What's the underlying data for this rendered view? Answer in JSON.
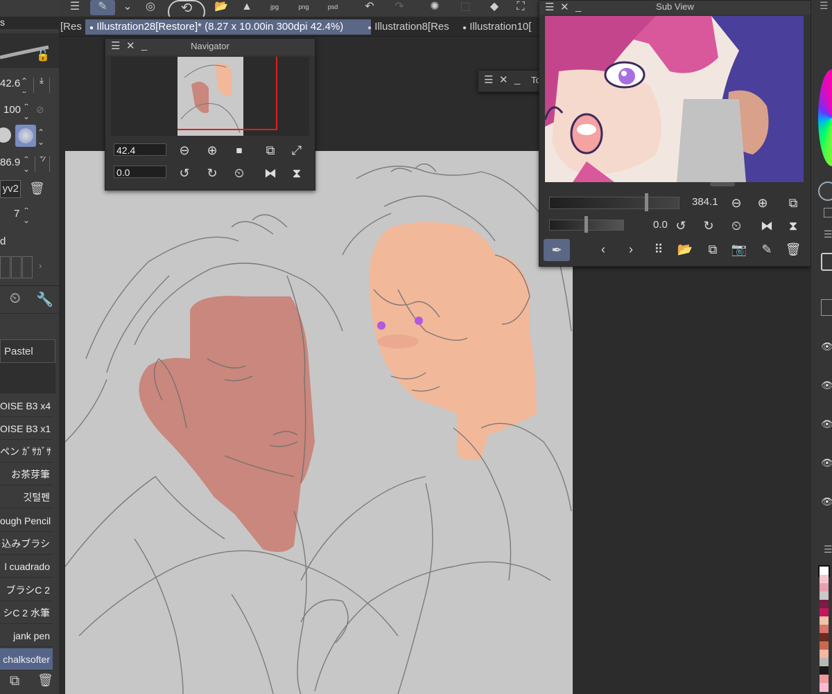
{
  "toolbar": {
    "icons": [
      "menu-icon",
      "pen-tool-icon",
      "chevron-down-icon",
      "spiral-icon",
      "rotate-icon",
      "folder-icon",
      "image-icon",
      "export-jpg-icon",
      "export-png-icon",
      "export-psd-icon",
      "undo-icon",
      "redo-icon",
      "loading-icon",
      "transform-icon",
      "fill-icon",
      "crop-icon"
    ],
    "export_jpg": "jpg",
    "export_png": "png",
    "export_psd": "psd"
  },
  "tabs": [
    {
      "label": "[Res"
    },
    {
      "label": "Illustration28[Restore]* (8.27 x 10.00in 300dpi 42.4%)"
    },
    {
      "label": "Illustration8[Res"
    },
    {
      "label": "Illustration10["
    }
  ],
  "left_panel": {
    "header_fragment": "s",
    "size_value": "42.6",
    "opacity_value": "100",
    "density_value": "86.9",
    "brush_name_field": "yv2",
    "stabilizer_value": "7",
    "blend_label": "d",
    "group_label": "Pastel",
    "brushes": [
      "OISE B3 x4",
      "OISE B3 x1",
      "ペン ｶﾞｻｶﾞｻ",
      "お茶芽筆",
      "깃털펜",
      "ough Pencil",
      "込みブラシ",
      "l cuadrado",
      "ブラシC 2",
      "シC 2 水筆",
      "jank pen",
      "chalksofter"
    ],
    "selected_brush": "chalksofter"
  },
  "navigator": {
    "title": "Navigator",
    "zoom_value": "42.4",
    "rotation_value": "0.0"
  },
  "tool_window": {
    "title": "To"
  },
  "subview": {
    "title": "Sub View",
    "zoom_value": "384.1",
    "rotation_value": "0.0"
  },
  "colors": {
    "accent": "#5a6785",
    "canvas_bg": "#c7c7c7",
    "skin_dark": "#c9877d",
    "skin_light": "#f2b89a",
    "sketch_line": "#6d6d6d",
    "eye_purple": "#b15adf"
  },
  "palette": [
    "#ffffff",
    "#f3c6cf",
    "#e6a1b0",
    "#c9c9c9",
    "#7b1a45",
    "#c2185b",
    "#f0c2a6",
    "#d9756b",
    "#6d2b1f",
    "#c96a4e",
    "#f4b7a0",
    "#b8b8b8",
    "#1a1a1a",
    "#ef9a9a",
    "#f8bbd0"
  ]
}
